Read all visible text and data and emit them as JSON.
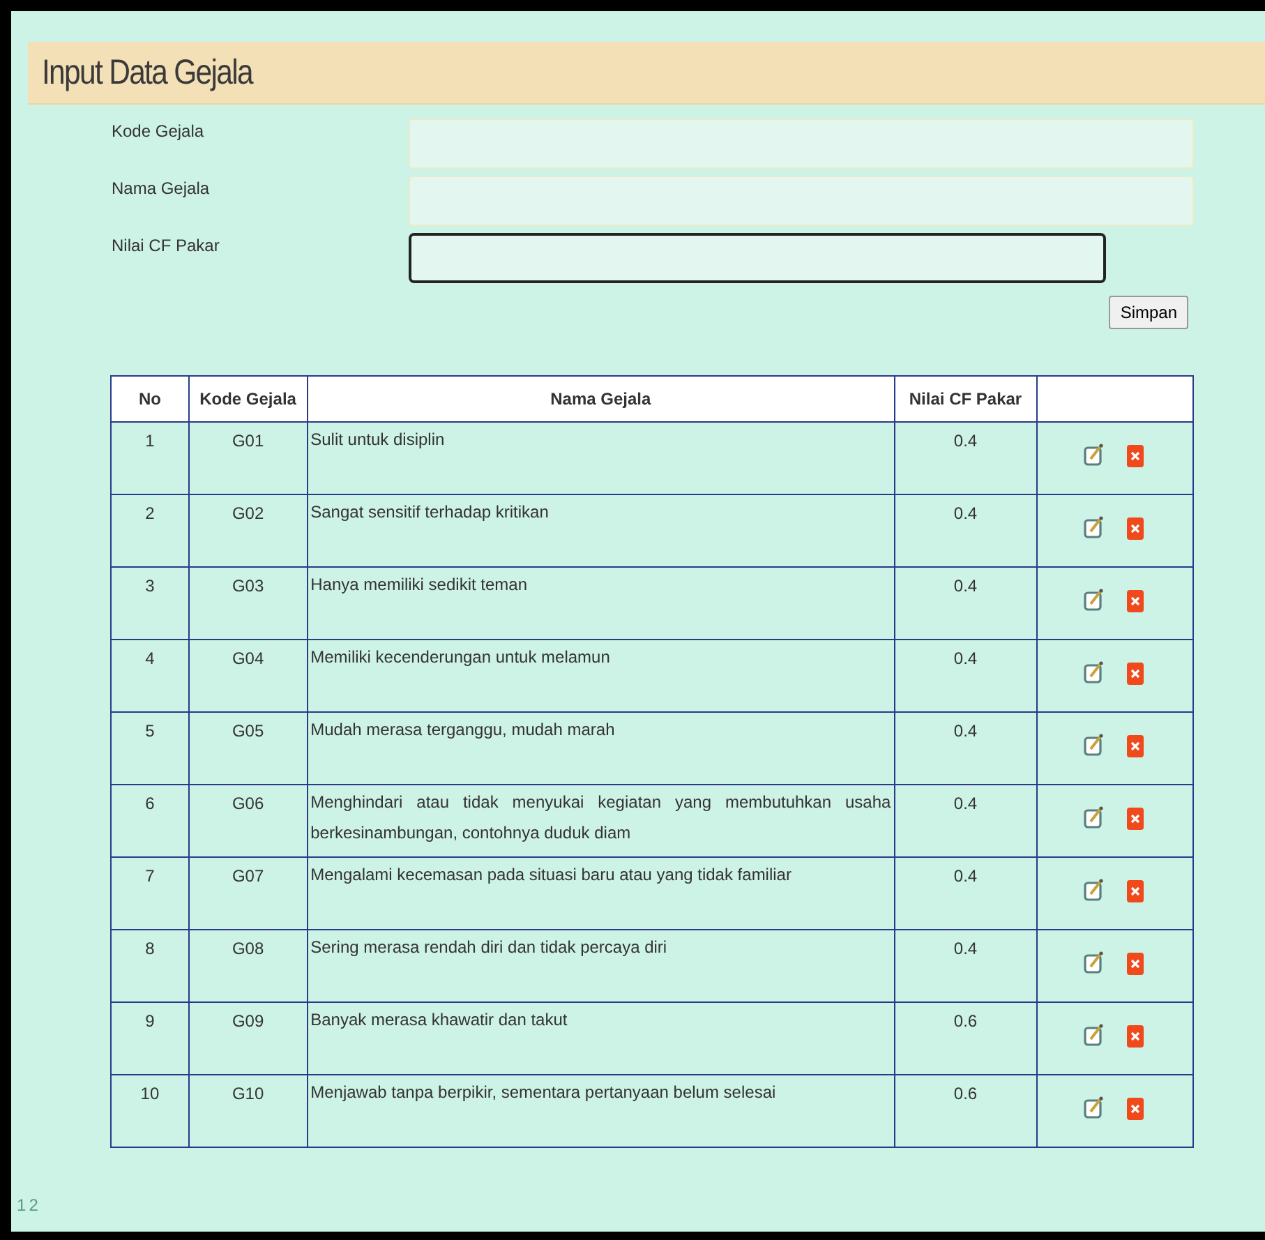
{
  "title": "Input Data Gejala",
  "form": {
    "fields": [
      {
        "label": "Kode Gejala",
        "focused": false
      },
      {
        "label": "Nama Gejala",
        "focused": false
      },
      {
        "label": "Nilai CF Pakar",
        "focused": true
      }
    ],
    "submit": "Simpan"
  },
  "table": {
    "columns": [
      "No",
      "Kode Gejala",
      "Nama Gejala",
      "Nilai CF Pakar"
    ],
    "rows": [
      {
        "no": "1",
        "kode": "G01",
        "nama": "Sulit untuk disiplin",
        "cf": "0.4"
      },
      {
        "no": "2",
        "kode": "G02",
        "nama": "Sangat sensitif terhadap kritikan",
        "cf": "0.4"
      },
      {
        "no": "3",
        "kode": "G03",
        "nama": "Hanya memiliki sedikit teman",
        "cf": "0.4"
      },
      {
        "no": "4",
        "kode": "G04",
        "nama": "Memiliki kecenderungan untuk melamun",
        "cf": "0.4"
      },
      {
        "no": "5",
        "kode": "G05",
        "nama": "Mudah merasa terganggu, mudah marah",
        "cf": "0.4"
      },
      {
        "no": "6",
        "kode": "G06",
        "nama": "Menghindari atau tidak menyukai kegiatan yang membutuhkan usaha berkesinambungan, contohnya duduk diam",
        "cf": "0.4"
      },
      {
        "no": "7",
        "kode": "G07",
        "nama": "Mengalami kecemasan pada situasi baru atau yang tidak familiar",
        "cf": "0.4"
      },
      {
        "no": "8",
        "kode": "G08",
        "nama": "Sering merasa rendah diri dan tidak percaya diri",
        "cf": "0.4"
      },
      {
        "no": "9",
        "kode": "G09",
        "nama": "Banyak merasa khawatir dan takut",
        "cf": "0.6"
      },
      {
        "no": "10",
        "kode": "G10",
        "nama": "Menjawab tanpa berpikir, sementara pertanyaan belum selesai",
        "cf": "0.6"
      }
    ]
  },
  "pagination": [
    "1",
    "2"
  ]
}
